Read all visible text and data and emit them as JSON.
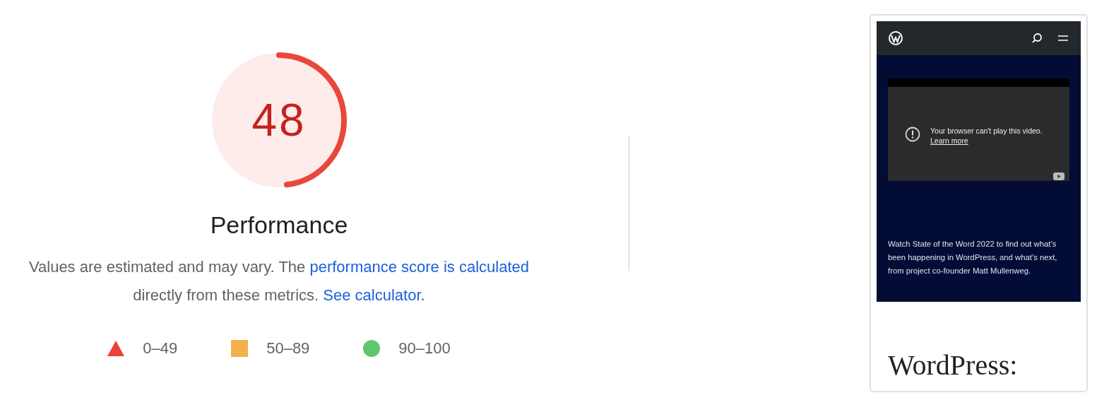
{
  "gauge": {
    "score": "48",
    "level": 0.48
  },
  "category": {
    "title": "Performance"
  },
  "description": [
    {
      "kind": "text",
      "text": "Values are estimated and may vary. The "
    },
    {
      "kind": "link",
      "text": "performance score is calculated"
    },
    {
      "kind": "text",
      "text": " directly from these metrics. "
    },
    {
      "kind": "link",
      "text": "See calculator."
    }
  ],
  "legend": [
    {
      "kind": "triangle",
      "color": "#eb4335",
      "label": "0–49"
    },
    {
      "kind": "square",
      "color": "#f4b04d",
      "label": "50–89"
    },
    {
      "kind": "circle",
      "color": "#5ec86a",
      "label": "90–100"
    }
  ],
  "screenshot": {
    "video_message": "Your browser can't play this video.",
    "video_link": "Learn more",
    "caption": "Watch State of the Word 2022 to find out what’s been happening in WordPress, and what’s next, from project co-founder Matt Mullenweg.",
    "heading": "WordPress:"
  }
}
